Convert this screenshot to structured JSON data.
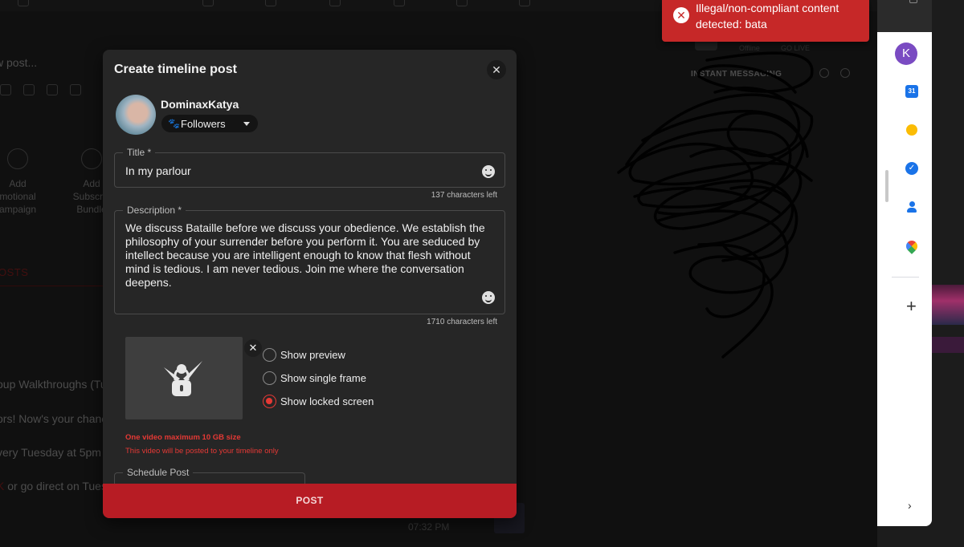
{
  "background": {
    "new_post_placeholder": "w post...",
    "cards": [
      {
        "line1": "Add",
        "line2": "motional",
        "line3": "ampaign"
      },
      {
        "line1": "Add",
        "line2": "Subscrip",
        "line3": "Bundle"
      }
    ],
    "posts_tab": "OSTS",
    "feed_lines": [
      "oup Walkthroughs (Tu",
      "ors! Now's your chanc",
      "very Tuesday at 5pm"
    ],
    "feed_last_red": "K",
    "feed_last_rest": " or go direct on Tues",
    "instant_messaging": "INSTANT MESSAGING",
    "offline": "Offline",
    "go_live": "GO LIVE",
    "message_time": "07:32 PM"
  },
  "toast": {
    "message": "Illegal/non-compliant content detected: bata",
    "color": "#c62828"
  },
  "side_panel": {
    "profile_initial": "K",
    "calendar_day": "31",
    "add_label": "+",
    "expand_label": "›"
  },
  "modal": {
    "title": "Create timeline post",
    "close_label": "✕",
    "username": "DominaxKatya",
    "audience": "Followers",
    "title_field": {
      "label": "Title *",
      "value": "In my parlour",
      "counter": "137 characters left"
    },
    "description_field": {
      "label": "Description *",
      "value": "We discuss Bataille before we discuss your obedience. We establish the philosophy of your surrender before you perform it. You are seduced by intellect because you are intelligent enough to know that flesh without mind is tedious. I am never tedious. Join me where the conversation deepens.",
      "counter": "1710 characters left"
    },
    "video_options": [
      {
        "label": "Show preview",
        "selected": false
      },
      {
        "label": "Show single frame",
        "selected": false
      },
      {
        "label": "Show locked screen",
        "selected": true
      }
    ],
    "video_limit_note": "One video maximum 10 GB size",
    "video_post_note": "This video will be posted to your timeline only",
    "schedule_label": "Schedule Post",
    "post_button": "POST",
    "accent_color": "#b71c24"
  }
}
